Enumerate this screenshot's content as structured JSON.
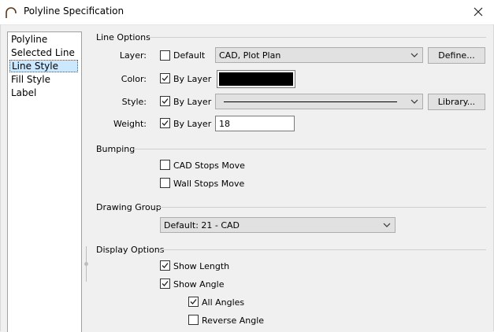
{
  "window": {
    "title": "Polyline Specification"
  },
  "nav": {
    "items": [
      {
        "label": "Polyline"
      },
      {
        "label": "Selected Line"
      },
      {
        "label": "Line Style"
      },
      {
        "label": "Fill Style"
      },
      {
        "label": "Label"
      }
    ],
    "selected": "Line Style"
  },
  "line_options": {
    "group_label": "Line Options",
    "layer": {
      "label": "Layer:",
      "checkbox_label": "Default",
      "checked": false,
      "value": "CAD, Plot Plan",
      "button": "Define..."
    },
    "color": {
      "label": "Color:",
      "checkbox_label": "By Layer",
      "checked": true,
      "swatch": "#000000"
    },
    "style": {
      "label": "Style:",
      "checkbox_label": "By Layer",
      "checked": true,
      "button": "Library..."
    },
    "weight": {
      "label": "Weight:",
      "checkbox_label": "By Layer",
      "checked": true,
      "value": "18"
    }
  },
  "bumping": {
    "group_label": "Bumping",
    "cad_stops_move": {
      "label": "CAD Stops Move",
      "checked": false
    },
    "wall_stops_move": {
      "label": "Wall Stops Move",
      "checked": false
    }
  },
  "drawing_group": {
    "group_label": "Drawing Group",
    "value": "Default: 21 - CAD"
  },
  "display_options": {
    "group_label": "Display Options",
    "show_length": {
      "label": "Show Length",
      "checked": true
    },
    "show_angle": {
      "label": "Show Angle",
      "checked": true
    },
    "all_angles": {
      "label": "All Angles",
      "checked": true
    },
    "reverse_angle": {
      "label": "Reverse Angle",
      "checked": false
    }
  },
  "icons": {
    "app": "arc-icon",
    "close": "close-icon",
    "dropdown": "chevron-down-icon",
    "check": "checkmark-icon"
  }
}
